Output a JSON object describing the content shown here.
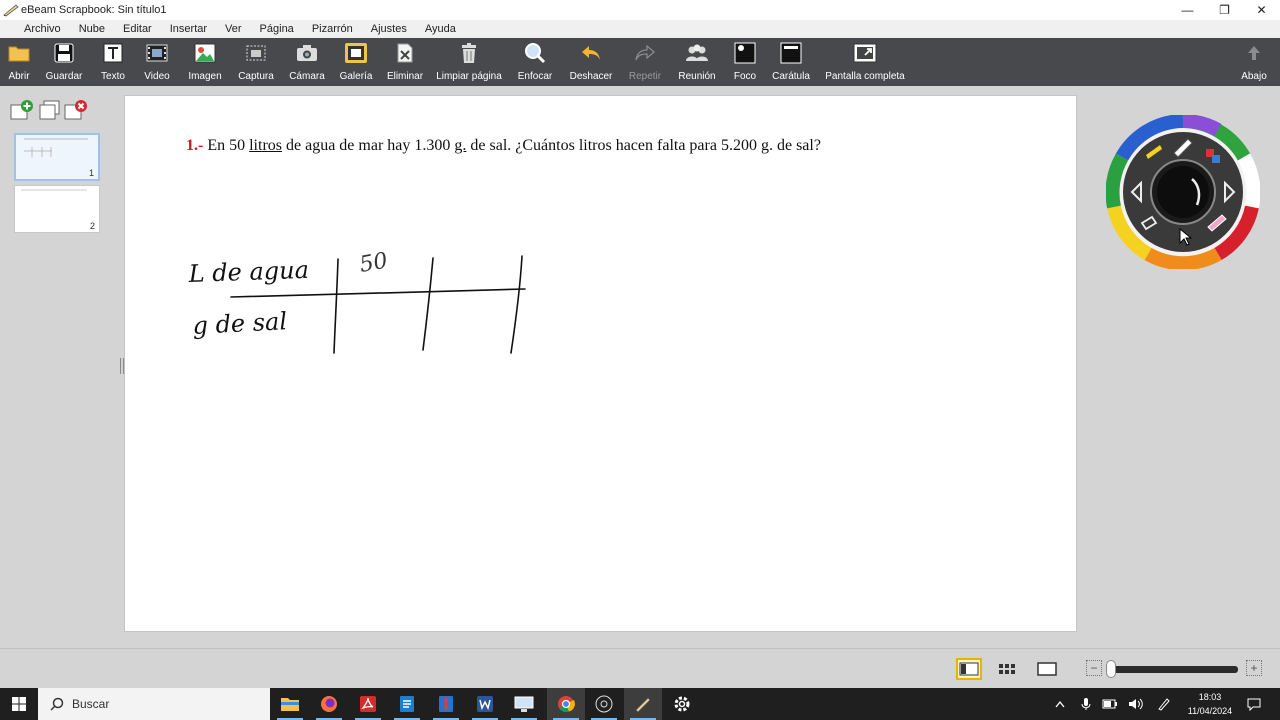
{
  "window": {
    "title": "eBeam Scrapbook: Sin título1",
    "controls": [
      "—",
      "❐",
      "✕"
    ]
  },
  "menu": [
    "Archivo",
    "Nube",
    "Editar",
    "Insertar",
    "Ver",
    "Página",
    "Pizarrón",
    "Ajustes",
    "Ayuda"
  ],
  "toolbar": {
    "abrir": "Abrir",
    "guardar": "Guardar",
    "texto": "Texto",
    "video": "Video",
    "imagen": "Imagen",
    "captura": "Captura",
    "camara": "Cámara",
    "galeria": "Galería",
    "eliminar": "Eliminar",
    "limpiar": "Limpiar página",
    "enfocar": "Enfocar",
    "deshacer": "Deshacer",
    "repetir": "Repetir",
    "reunion": "Reunión",
    "foco": "Foco",
    "caratula": "Carátula",
    "pantalla": "Pantalla completa",
    "abajo": "Abajo"
  },
  "pages": {
    "items": [
      {
        "number": "1",
        "active": true
      },
      {
        "number": "2",
        "active": false
      }
    ]
  },
  "problem": {
    "number": "1",
    "sep": ".-",
    "p1": " En 50 ",
    "u1": "litros",
    "p2": " de agua de mar hay 1.300 ",
    "u2": "g.",
    "p3": " de sal. ¿Cuántos litros hacen falta para 5.200 g. de sal?"
  },
  "handwriting": {
    "row1": "L de agua",
    "row2": "g de sal",
    "value": "50"
  },
  "colors": {
    "toolbar": "#47494d",
    "accent_red": "#d0121b",
    "view_active": "#e8b400"
  },
  "zoom": {
    "level": 0
  },
  "taskbar": {
    "search_placeholder": "Buscar",
    "time": "18:03",
    "date": "11/04/2024"
  }
}
